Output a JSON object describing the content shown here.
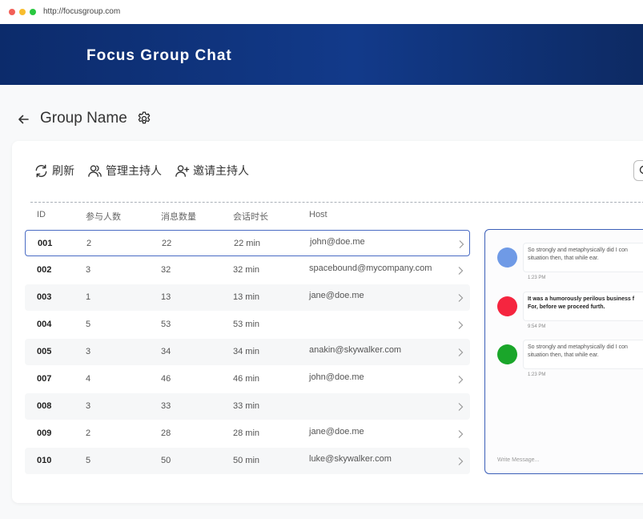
{
  "browser": {
    "url": "http://focusgroup.com"
  },
  "header": {
    "title": "Focus Group Chat"
  },
  "page": {
    "group_name": "Group Name"
  },
  "toolbar": {
    "refresh_label": "刷新",
    "manage_hosts_label": "管理主持人",
    "invite_host_label": "邀请主持人"
  },
  "table": {
    "columns": [
      "ID",
      "参与人数",
      "消息数量",
      "会话时长",
      "Host"
    ],
    "rows": [
      {
        "id": "001",
        "participants": "2",
        "messages": "22",
        "duration": "22 min",
        "host": "john@doe.me"
      },
      {
        "id": "002",
        "participants": "3",
        "messages": "32",
        "duration": "32 min",
        "host": "spacebound@mycompany.com"
      },
      {
        "id": "003",
        "participants": "1",
        "messages": "13",
        "duration": "13 min",
        "host": "jane@doe.me"
      },
      {
        "id": "004",
        "participants": "5",
        "messages": "53",
        "duration": "53 min",
        "host": ""
      },
      {
        "id": "005",
        "participants": "3",
        "messages": "34",
        "duration": "34 min",
        "host": "anakin@skywalker.com"
      },
      {
        "id": "007",
        "participants": "4",
        "messages": "46",
        "duration": "46 min",
        "host": "john@doe.me"
      },
      {
        "id": "008",
        "participants": "3",
        "messages": "33",
        "duration": "33 min",
        "host": ""
      },
      {
        "id": "009",
        "participants": "2",
        "messages": "28",
        "duration": "28 min",
        "host": "jane@doe.me"
      },
      {
        "id": "010",
        "participants": "5",
        "messages": "50",
        "duration": "50 min",
        "host": "luke@skywalker.com"
      }
    ]
  },
  "chat": {
    "messages": [
      {
        "line1": "So strongly and metaphysically did I con",
        "line2": "situation then, that while ear.",
        "time": "1:23 PM",
        "avatar_color": "#6f9ae6",
        "bold": false
      },
      {
        "line1": "It was a humorously perilous business f",
        "line2": "For, before we proceed furth.",
        "time": "9:54 PM",
        "avatar_color": "#f5253f",
        "bold": true
      },
      {
        "line1": "So strongly and metaphysically did I con",
        "line2": "situation then, that while ear.",
        "time": "1:23 PM",
        "avatar_color": "#1aa62a",
        "bold": false
      }
    ],
    "input_placeholder": "Write Message..."
  },
  "colors": {
    "header_gradient_start": "#0c2b6b",
    "header_gradient_end": "#123a8a",
    "selection_border": "#4a6cc4",
    "chat_border": "#3b5fb8"
  }
}
